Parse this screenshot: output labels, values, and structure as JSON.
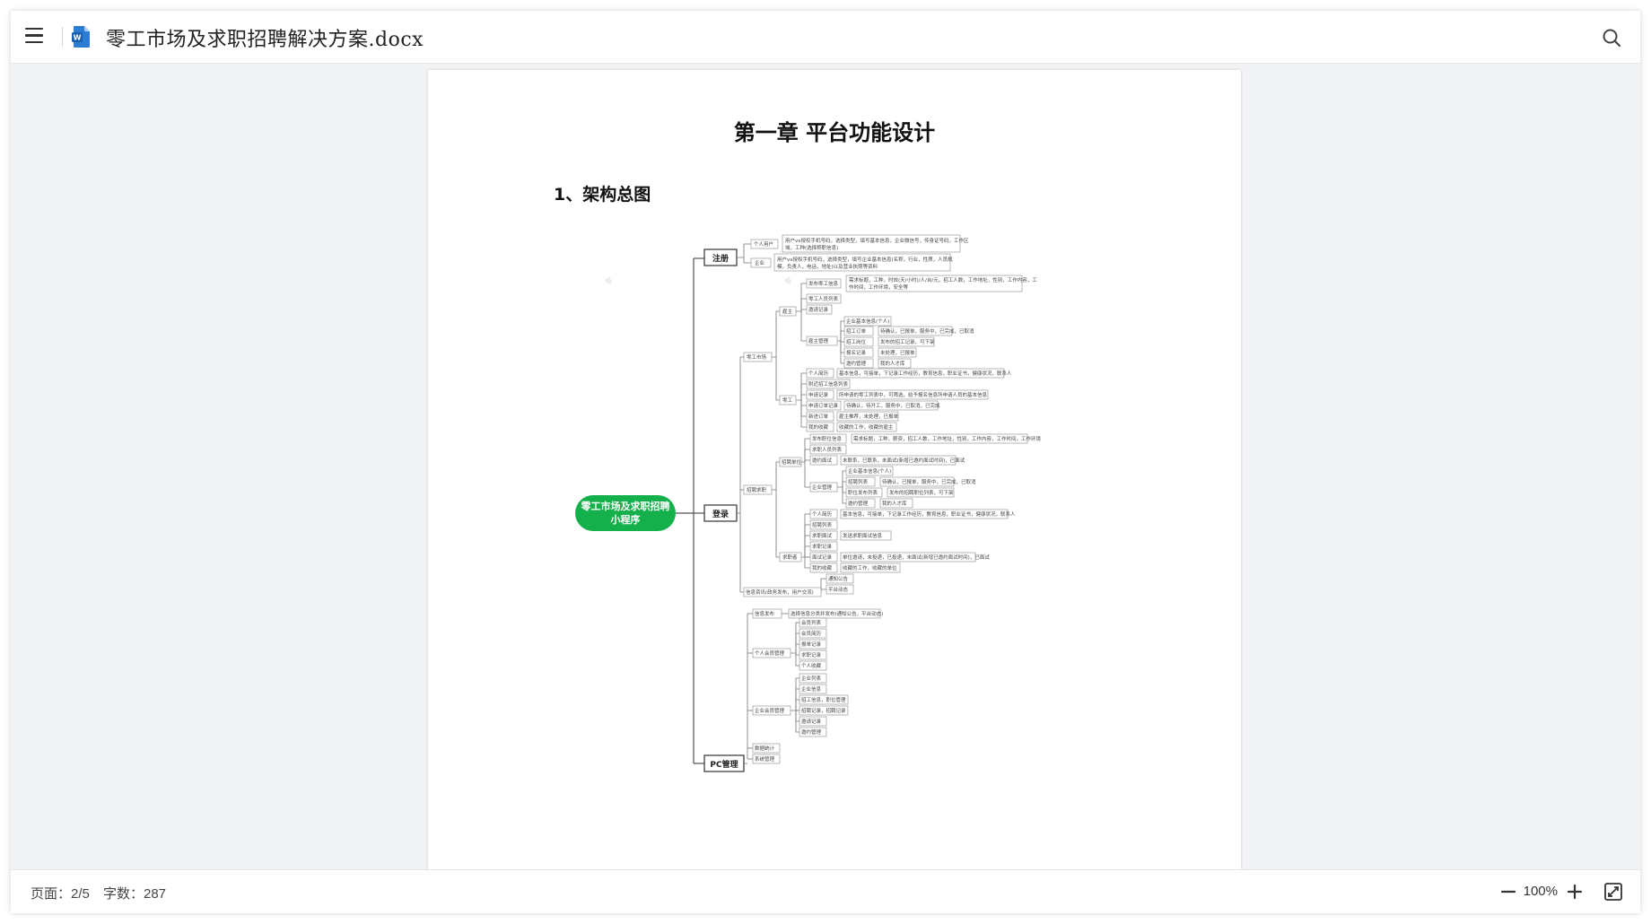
{
  "window": {
    "title": "零工市场及求职招聘解决方案.docx",
    "file_icon": "word-doc-icon"
  },
  "document": {
    "chapter_title": "第一章  平台功能设计",
    "section_title": "1、架构总图",
    "mindmap": {
      "root": "零工市场及求职招聘小程序",
      "branches": [
        "注册",
        "登录",
        "PC管理"
      ],
      "nodes": {
        "geren_yonghu": "个人用户",
        "geren_desc": "用户vx授权手机号码，选择类型，填写基本信息，企业微信号，传身证号码，工作区域，工种(选择称职信息)",
        "qiye": "企业",
        "qiye_desc": "用户vx授权手机号码，选择类型，填写企业基本信息(名称，行业，性质，人员规模，负责人，电话，地址)以及营业执照等资料",
        "linggong_shichang": "零工市场",
        "guzhu": "雇主",
        "fabu_linggong": "发布零工信息",
        "fabu_linggong_desc": "需求标题，工种，时效(天/小时)/人/台/元，招工人数，工作地址，性别，工作内容，工作时间，工作环境，安全等",
        "linggong_renyuan": "零工人员列表",
        "yaoqing_jilu": "邀请记录",
        "guzhu_guanli": "雇主管理",
        "qiye_jiben_xinxi": "企业基本信息(个人)",
        "zhaogong_dingdan": "招工订单",
        "zhaogong_dingdan_desc": "待确认，已报单，服务中，已完成，已取消",
        "zhaogong_gangwei": "招工岗位",
        "zhaogong_gangwei_desc": "发布的招工记录，可下架",
        "baoming_jilu": "报名记录",
        "baoming_jilu_desc": "未处理，已报单",
        "yaoqing_guanli": "邀约管理",
        "yaoqing_guanli_desc": "我的人才库",
        "linggong": "零工",
        "geren_ziliao": "个人简历",
        "geren_ziliao_desc": "基本信息，可接单，下记录工作经历，教育信息，职业证书，健康状况，联系人",
        "fujin_zhaogong": "附近招工信息列表",
        "shenqing_jilu": "申请记录",
        "shenqing_jilu_desc": "所申请的零工列表中，可筛选，给予报名信息所申请人员的基本信息",
        "shenqing_dingdan": "申请订单记录",
        "shenqing_dingdan_desc": "待确认，待开工，服务中，已取消，已完成",
        "xinxi_dingdan": "新进订单",
        "xinxi_dingdan_desc": "雇主推荐，未处理，已报单",
        "wode_shoucang": "我的收藏",
        "wode_shoucang_desc": "收藏的工作，收藏的雇主",
        "zhaopin_qiuzhi": "招聘求职",
        "zhaopin_danwei": "招聘单位",
        "fabu_zhiwei": "发布职位信息",
        "fabu_zhiwei_desc": "需求标题，工种，薪资，招工人数，工作地址，性别，工作内容，工作时间，工作环境",
        "qiuzhi_renyuan": "求职人员列表",
        "mianshi_guanli": "邀约面试",
        "mianshi_guanli_desc": "未联系，已联系，未面试(新增已邀约面试时间)，已面试",
        "qiye_guanli": "企业管理",
        "qiye_jiben_xinxi2": "企业基本信息(个人)",
        "zhaopin_liebiao": "招聘列表",
        "zhaopin_liebiao_desc": "待确认，已报单，服务中，已完成，已取消",
        "zhiwei_fabu_liebiao": "职位发布列表",
        "zhiwei_fabu_liebiao_desc": "发布的招聘职位列表，可下架",
        "yaoqing_guanli2": "邀约管理",
        "yaoqing_guanli2_desc": "我的人才库",
        "qiuzhizhe": "求职者",
        "geren_jianli2": "个人简历",
        "geren_jianli2_desc": "基本信息，可接单，下记录工作经历，教育信息，职业证书，健康状况，联系人",
        "zhaopin_liebiao2": "招聘列表",
        "qiuzhi_mianshi": "求职面试",
        "qiuzhi_mianshi_desc": "发送求职面试信息",
        "qiuzhi_jilu": "求职记录",
        "mianshi_jilu": "面试记录",
        "mianshi_jilu_desc": "单位邀请，未投递，已投递，未面试(新增已邀约面试时间)，已面试",
        "wode_shoucang2": "我的收藏",
        "wode_shoucang2_desc": "收藏的工作，收藏的单位",
        "xinxi_faburen": "信息资讯(政务发布，用户交流)",
        "tongzhi_gonggao": "通知公告",
        "pingtai_dongtai": "平台动态",
        "xinxi_fabu": "信息发布",
        "xinxi_fabu_desc": "选择信息分类并发布(通知公告，平台动态)",
        "geren_huiyuan_guanli": "个人会员管理",
        "huiyuan_liebiao": "会员列表",
        "huiyuan_jianli": "会员简历",
        "baoming_jilu2": "报单记录",
        "qiuzhi_jilu2": "求职记录",
        "geren_shoucang": "个人收藏",
        "qiye_huiyuan_guanli": "企业会员管理",
        "qiye_liebiao": "企业列表",
        "qiye_xinxi": "企业信息",
        "zhaogong_xinxi": "招工信息，职位管理",
        "zhaogong_jilu": "招聘记录，招聘记录",
        "yaoqing_jilu2": "邀请记录",
        "yaoqing_guanli3": "邀约管理",
        "shuju_tongji": "数据统计",
        "xitong_guanli": "系统管理"
      }
    }
  },
  "status": {
    "page": "页面：2/5",
    "words": "字数：287",
    "zoom": "100%"
  },
  "colors": {
    "root_node": "#14b04b",
    "line": "#555555"
  },
  "icons": [
    "menu-icon",
    "word-doc-icon",
    "search-icon",
    "zoom-out-icon",
    "zoom-in-icon",
    "fullscreen-icon"
  ]
}
